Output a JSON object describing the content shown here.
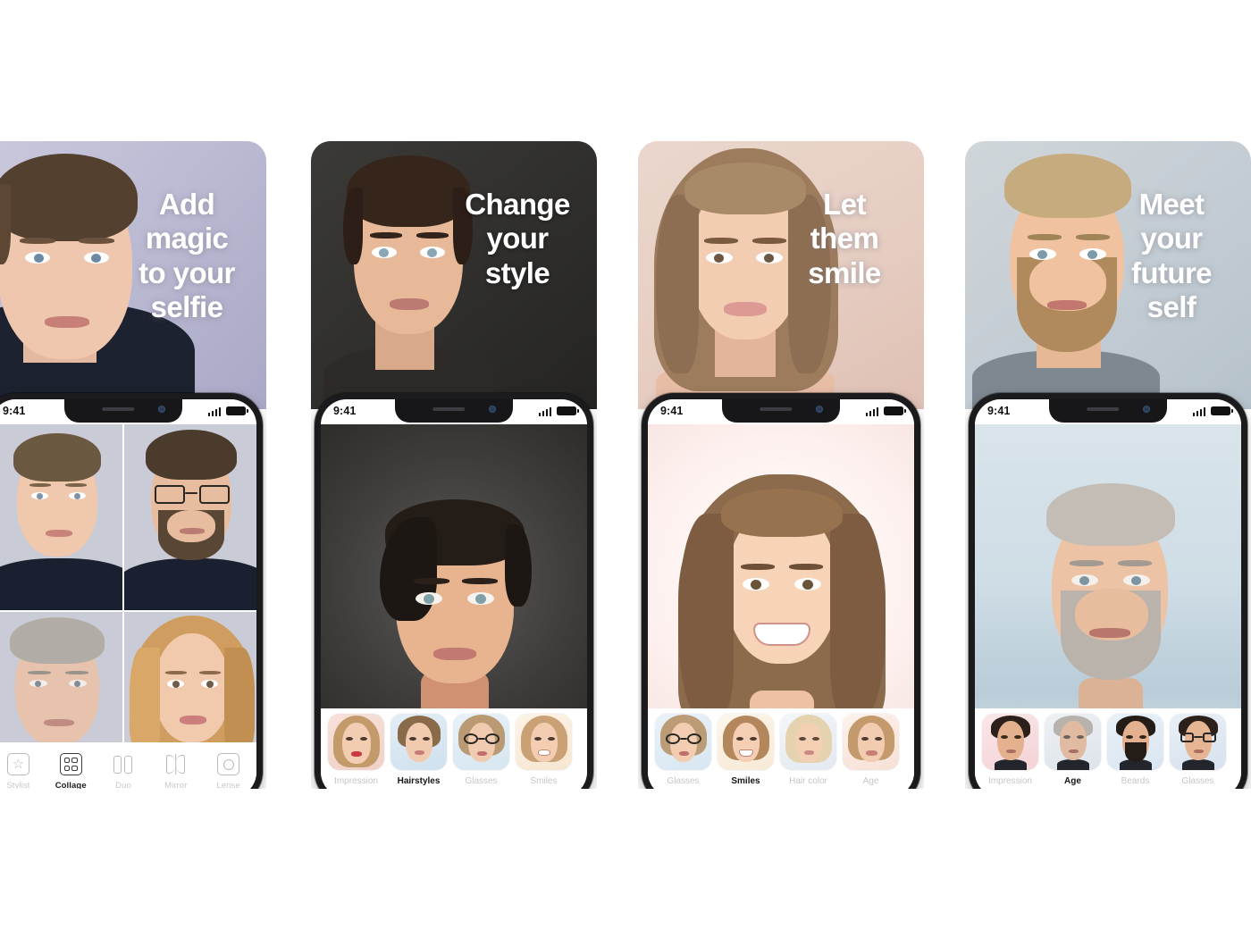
{
  "page": {
    "title": "FaceApp App Store screenshots",
    "background": "#ffffff",
    "panel_count": 4
  },
  "status_bar": {
    "time": "9:41",
    "signal_icon": "signal-bars-icon",
    "battery_icon": "battery-full-icon"
  },
  "panels": [
    {
      "id": "panel-add-magic",
      "tagline": "Add\nmagic\nto your\nselfie",
      "tagline_theme": "light",
      "hero_bg": "linear-gradient(130deg,#c9c8dc 0%,#b9b8d2 55%,#a9a8c6 100%)",
      "app_view": "collage",
      "collage_labels": [
        "young-man-original",
        "man-with-glasses-and-beard",
        "older-man-aged",
        "female-version"
      ],
      "toolbar_type": "tabbar",
      "tabs": [
        {
          "label": "Stylist",
          "icon": "star-frame-icon",
          "active": false
        },
        {
          "label": "Collage",
          "icon": "grid-four-icon",
          "active": true
        },
        {
          "label": "Duo",
          "icon": "two-panels-icon",
          "active": false
        },
        {
          "label": "Mirror",
          "icon": "mirror-icon",
          "active": false
        },
        {
          "label": "Lense",
          "icon": "lens-circle-icon",
          "active": false
        }
      ]
    },
    {
      "id": "panel-change-style",
      "tagline": "Change\nyour\nstyle",
      "tagline_theme": "dark",
      "hero_bg": "linear-gradient(140deg,#3b3a37 0%,#2e2d2b 60%,#252422 100%)",
      "app_view": "single-photo",
      "toolbar_type": "carousel",
      "carousel": [
        {
          "label": "Impression",
          "active": false
        },
        {
          "label": "Hairstyles",
          "active": true
        },
        {
          "label": "Glasses",
          "active": false
        },
        {
          "label": "Smiles",
          "active": false
        }
      ]
    },
    {
      "id": "panel-let-them-smile",
      "tagline": "Let\nthem\nsmile",
      "tagline_theme": "light",
      "hero_bg": "linear-gradient(150deg,#ead7cd 0%,#e6cdc2 55%,#dfc0b4 100%)",
      "app_view": "single-photo",
      "toolbar_type": "carousel",
      "carousel": [
        {
          "label": "Glasses",
          "active": false
        },
        {
          "label": "Smiles",
          "active": true
        },
        {
          "label": "Hair color",
          "active": false
        },
        {
          "label": "Age",
          "active": false
        }
      ]
    },
    {
      "id": "panel-meet-future-self",
      "tagline": "Meet\nyour\nfuture\nself",
      "tagline_theme": "light",
      "hero_bg": "linear-gradient(140deg,#cfd6da 0%,#c3ccd3 55%,#b6c2cb 100%)",
      "app_view": "single-photo",
      "toolbar_type": "carousel",
      "carousel": [
        {
          "label": "Impression",
          "active": false
        },
        {
          "label": "Age",
          "active": true
        },
        {
          "label": "Beards",
          "active": false
        },
        {
          "label": "Glasses",
          "active": false
        }
      ]
    }
  ]
}
